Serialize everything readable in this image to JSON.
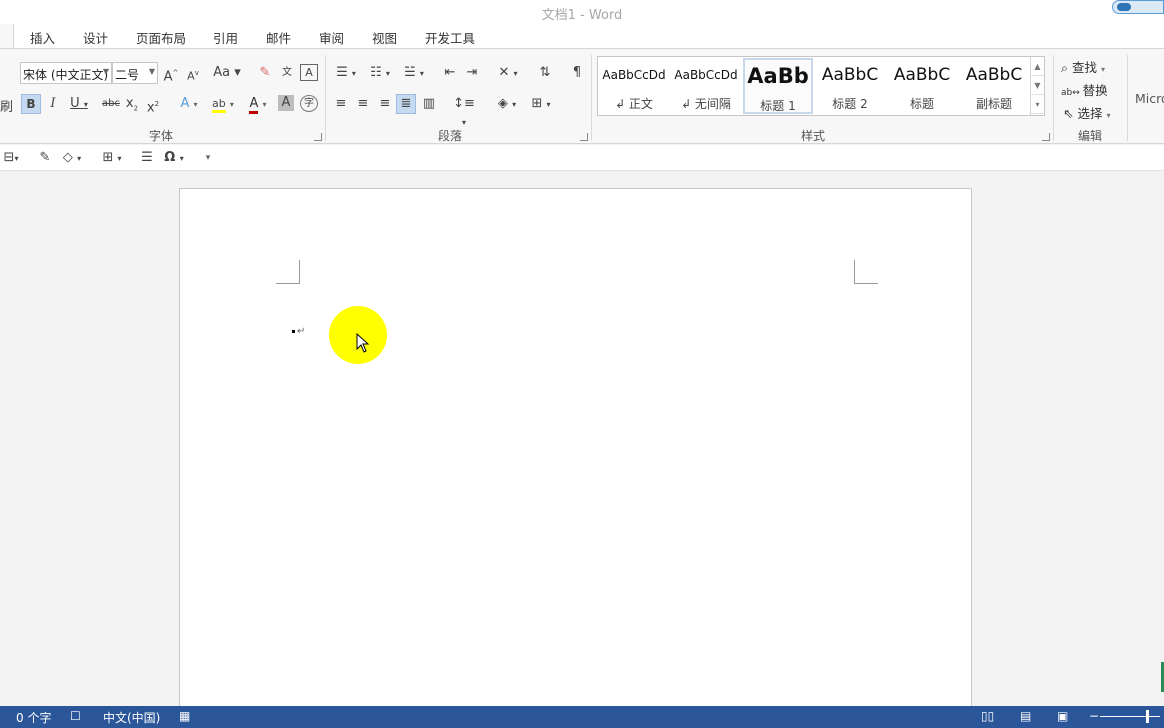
{
  "window": {
    "title": "文档1 - Word"
  },
  "tabs": [
    "插入",
    "设计",
    "页面布局",
    "引用",
    "邮件",
    "审阅",
    "视图",
    "开发工具"
  ],
  "font_group": {
    "font_name": "宋体 (中文正文)",
    "font_size": "二号",
    "label": "字体"
  },
  "paragraph_group": {
    "label": "段落"
  },
  "styles_group": {
    "label": "样式",
    "items": [
      {
        "sample": "AaBbCcDd",
        "name": "↲ 正文"
      },
      {
        "sample": "AaBbCcDd",
        "name": "↲ 无间隔"
      },
      {
        "sample": "AaBb",
        "name": "标题 1"
      },
      {
        "sample": "AaBbC",
        "name": "标题 2"
      },
      {
        "sample": "AaBbC",
        "name": "标题"
      },
      {
        "sample": "AaBbC",
        "name": "副标题"
      }
    ]
  },
  "editing_group": {
    "label": "编辑",
    "find": "查找",
    "replace": "替换",
    "select": "选择"
  },
  "addin_partial": "Micro",
  "statusbar": {
    "word_count": "0 个字",
    "language": "中文(中国)"
  },
  "colors": {
    "statusbar_bg": "#2b579a",
    "highlight": "#ffff00",
    "font_color": "#c00000"
  }
}
